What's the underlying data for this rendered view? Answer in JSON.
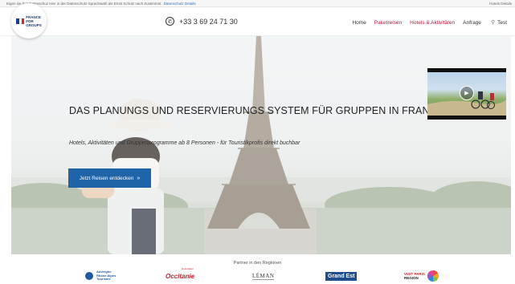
{
  "notice": {
    "text": "Eigen sie hiet Datenschuz Hier in der Datenschutz-Sprachwahl als Ernst Schutz nach Zustimmnt",
    "link": "Datenschutz Details",
    "right": "Hotels Details"
  },
  "header": {
    "logo": {
      "line1": "FRANCE",
      "line2": "FOR",
      "line3": "GROUPS",
      "flag_colors": [
        "#1f3f8f",
        "#ffffff",
        "#d3252f"
      ]
    },
    "phone": "+33 3 69 24 71 30",
    "nav": [
      {
        "label": "Home",
        "active": false
      },
      {
        "label": "Paketreisen",
        "active": true
      },
      {
        "label": "Hotels & Aktivitäten",
        "active": true
      },
      {
        "label": "Anfrage",
        "active": false
      }
    ],
    "user_label": "Test"
  },
  "hero": {
    "title": "DAS PLANUNGS UND RESERVIERUNGS SYSTEM FÜR GRUPPEN IN FRANKREICH",
    "subtitle": "Hotels, Aktivitäten und Gruppenprogramme ab 8 Personen - für Touristikprofis direkt buchbar",
    "cta_label": "Jetzt Reisen entdecken",
    "cta_icon": "double-chevron-right-icon"
  },
  "video": {
    "icon": "play-icon"
  },
  "partners": {
    "title": "Partner in den Regionen",
    "items": [
      {
        "name": "auvergne-rhone-alpes",
        "lines": [
          "Auvergne",
          "Rhône Alpes",
          "Tourisme"
        ]
      },
      {
        "name": "occitanie",
        "label": "Occitanie",
        "small": "Destination"
      },
      {
        "name": "leman",
        "label": "LÉMAN"
      },
      {
        "name": "grand-est",
        "label": "Grand Est"
      },
      {
        "name": "visit-paris-region",
        "line1": "VISIT PARIS",
        "line2": "REGION"
      }
    ]
  },
  "colors": {
    "accent": "#c0143c",
    "cta": "#1f63a8",
    "text": "#222222"
  }
}
